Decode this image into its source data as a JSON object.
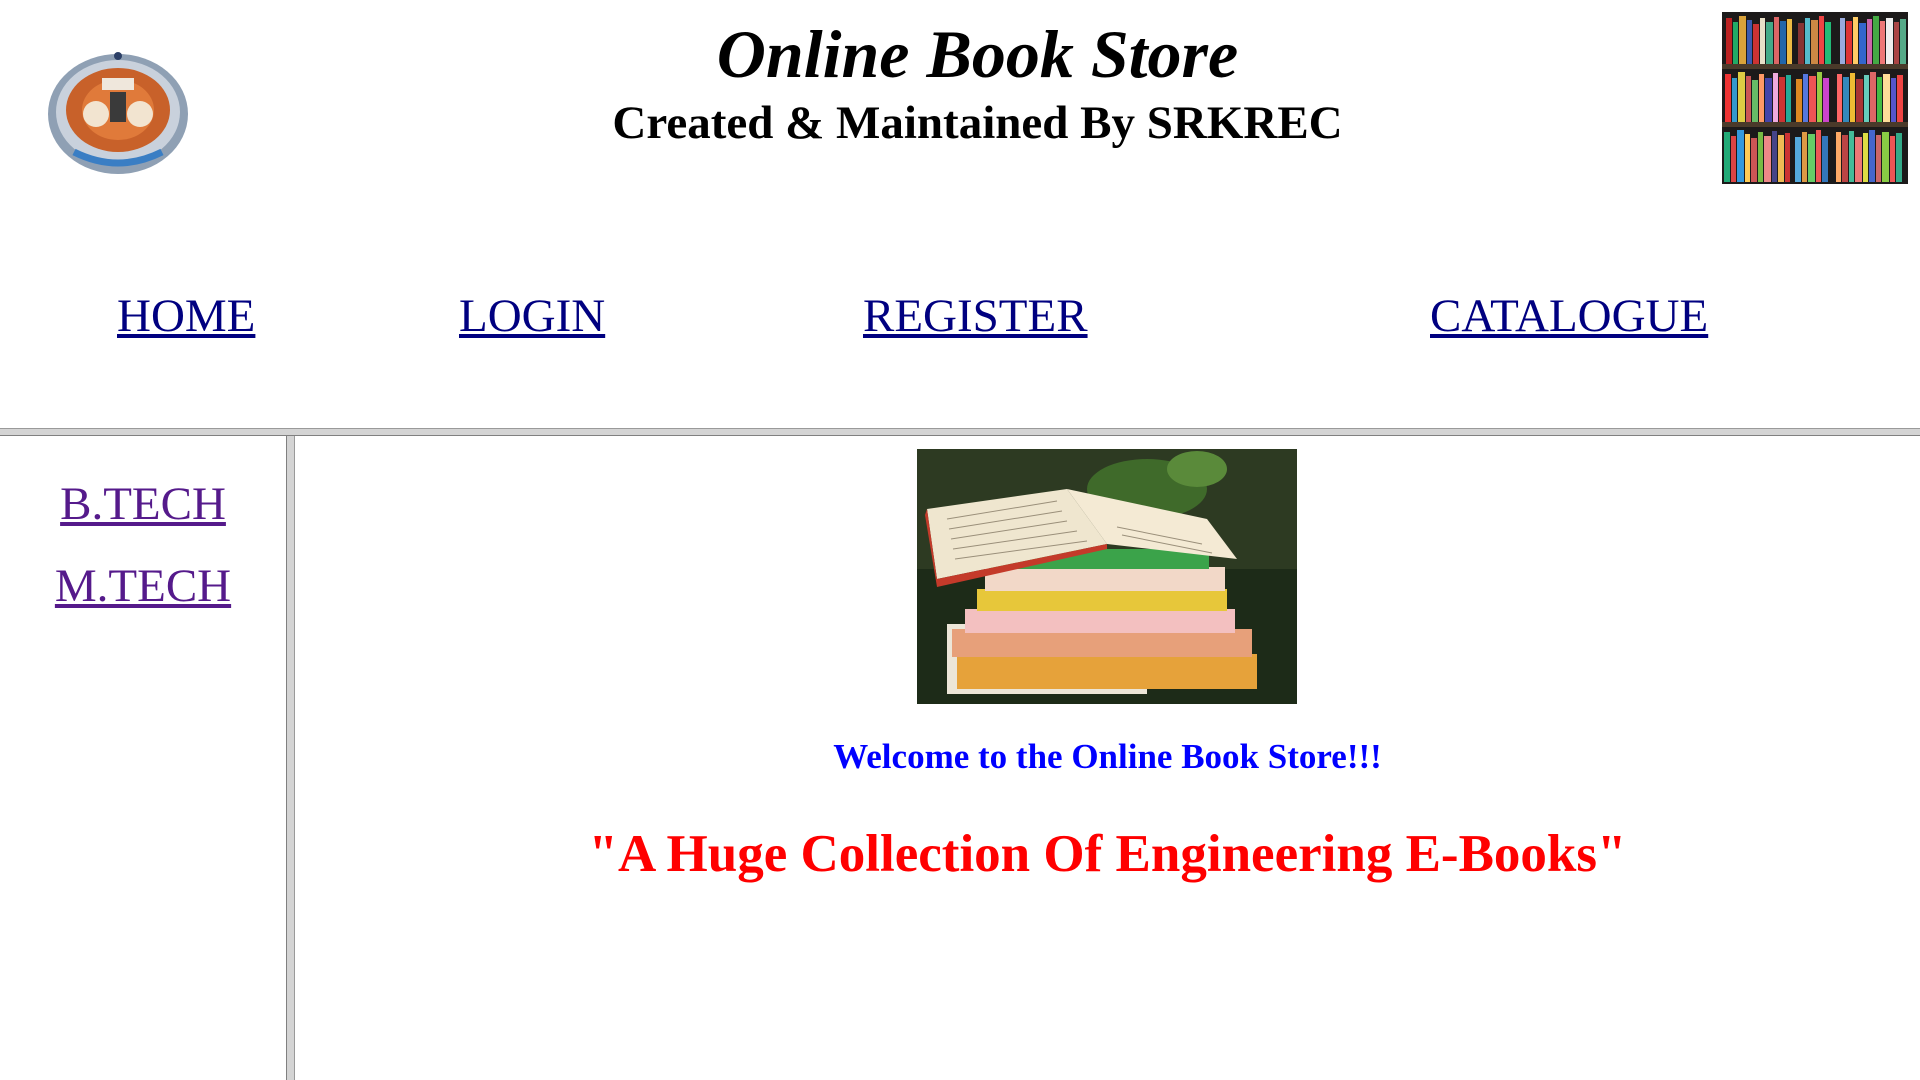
{
  "header": {
    "title": "Online Book Store",
    "subtitle": "Created & Maintained By SRKREC",
    "logo_icon": "college-seal-icon",
    "banner_image": "bookshelf-image"
  },
  "nav": {
    "home": "HOME",
    "login": "LOGIN",
    "register": "REGISTER",
    "catalogue": "CATALOGUE",
    "link_color": "#000080"
  },
  "sidebar": {
    "items": [
      {
        "label": "B.TECH"
      },
      {
        "label": "M.TECH"
      }
    ],
    "visited_color": "#551a8b"
  },
  "main": {
    "hero_image": "stacked-books-image",
    "welcome": "Welcome to the Online Book Store!!!",
    "tagline": "\"A Huge Collection Of Engineering E-Books\"",
    "welcome_color": "#0000ff",
    "tagline_color": "#ff0000"
  }
}
